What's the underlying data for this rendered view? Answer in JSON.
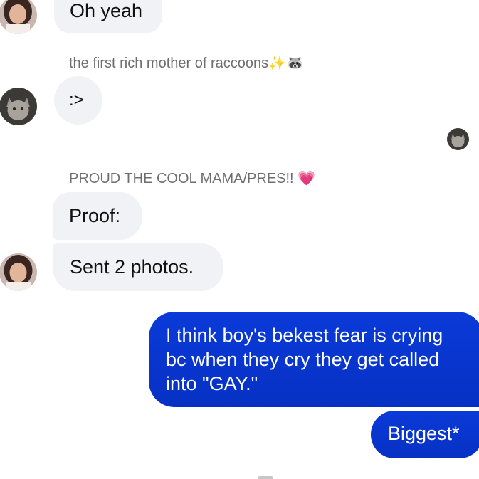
{
  "messages": [
    {
      "type": "incoming",
      "text": "Oh yeah"
    },
    {
      "type": "incoming",
      "sender": "the first rich mother of raccoons",
      "sender_emoji": "✨🦝",
      "text": ":>"
    },
    {
      "type": "incoming",
      "sender": "PROUD THE COOL MAMA/PRES!!",
      "sender_emoji": "💗",
      "text": "Proof:"
    },
    {
      "type": "incoming",
      "text": "Sent 2 photos."
    },
    {
      "type": "outgoing",
      "lines": [
        "I think boy's bekest fear is crying",
        "bc when they cry they get called",
        "into \"GAY.\""
      ]
    },
    {
      "type": "outgoing",
      "text": "Biggest*"
    }
  ],
  "avatars": {
    "girl": "girl-avatar",
    "cat": "cat-avatar"
  },
  "colors": {
    "incoming_bubble": "#f1f2f6",
    "outgoing_bubble": "#0a36d0",
    "sender_name": "#6e6e6e"
  }
}
